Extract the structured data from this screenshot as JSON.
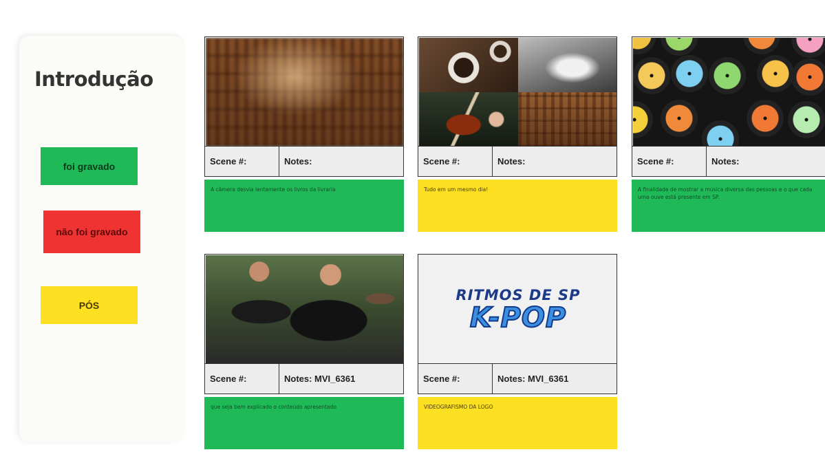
{
  "sidebar": {
    "title": "Introdução",
    "legend": {
      "recorded": "foi gravado",
      "not_recorded": "não foi gravado",
      "post": "PÓS"
    }
  },
  "colors": {
    "recorded": "#1fb957",
    "not_recorded": "#ef3232",
    "post": "#fde021"
  },
  "cards": [
    {
      "scene_label": "Scene #:",
      "notes_label": "Notes:",
      "note_text": "A câmera desvia lentamente os livros da livraria",
      "status": "recorded",
      "image": "bookstore-shelves"
    },
    {
      "scene_label": "Scene #:",
      "notes_label": "Notes:",
      "note_text": "Tudo em um mesmo dia!",
      "status": "post",
      "image": "coffee-hands-violin-collage"
    },
    {
      "scene_label": "Scene #:",
      "notes_label": "Notes:",
      "note_text": "A finalidade de mostrar a música diversa das pessoas e o que cada uma ouve está presente em SP.",
      "status": "recorded",
      "image": "colorful-vinyl-records"
    },
    {
      "scene_label": "Scene #:",
      "notes_label": "Notes: MVI_6361",
      "note_text": "que seja bem explicado o conteúdo apresentado",
      "status": "recorded",
      "image": "kpop-crowd"
    },
    {
      "scene_label": "Scene #:",
      "notes_label": "Notes: MVI_6361",
      "note_text": "VIDEOGRAFISMO DA LOGO",
      "status": "post",
      "image": "ritmos-de-sp-logo",
      "logo_line1": "RITMOS DE SP",
      "logo_line2": "K-POP"
    }
  ]
}
